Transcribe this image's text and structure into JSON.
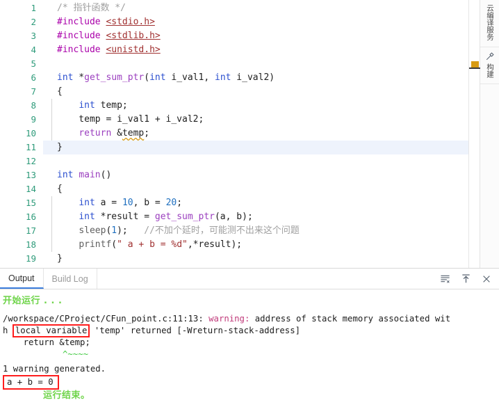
{
  "editor": {
    "lines": [
      {
        "no": "1",
        "guide": false,
        "highlight": false,
        "tokens": [
          {
            "c": "t-com",
            "t": "/* 指针函数 */"
          }
        ]
      },
      {
        "no": "2",
        "guide": false,
        "highlight": false,
        "tokens": [
          {
            "c": "t-pre",
            "t": "#include "
          },
          {
            "c": "t-hdr",
            "t": "<stdio.h>"
          }
        ]
      },
      {
        "no": "3",
        "guide": false,
        "highlight": false,
        "tokens": [
          {
            "c": "t-pre",
            "t": "#include "
          },
          {
            "c": "t-hdr",
            "t": "<stdlib.h>"
          }
        ]
      },
      {
        "no": "4",
        "guide": false,
        "highlight": false,
        "tokens": [
          {
            "c": "t-pre",
            "t": "#include "
          },
          {
            "c": "t-hdr",
            "t": "<unistd.h>"
          }
        ]
      },
      {
        "no": "5",
        "guide": false,
        "highlight": false,
        "tokens": []
      },
      {
        "no": "6",
        "guide": false,
        "highlight": false,
        "tokens": [
          {
            "c": "t-kw",
            "t": "int"
          },
          {
            "c": "t-op",
            "t": " *"
          },
          {
            "c": "t-fn",
            "t": "get_sum_ptr"
          },
          {
            "c": "t-op",
            "t": "("
          },
          {
            "c": "t-kw",
            "t": "int"
          },
          {
            "c": "t-id",
            "t": " i_val1, "
          },
          {
            "c": "t-kw",
            "t": "int"
          },
          {
            "c": "t-id",
            "t": " i_val2"
          },
          {
            "c": "t-op",
            "t": ")"
          }
        ]
      },
      {
        "no": "7",
        "guide": false,
        "highlight": false,
        "tokens": [
          {
            "c": "t-op",
            "t": "{"
          }
        ]
      },
      {
        "no": "8",
        "guide": true,
        "highlight": false,
        "tokens": [
          {
            "c": "t-op",
            "t": "    "
          },
          {
            "c": "t-kw",
            "t": "int"
          },
          {
            "c": "t-id",
            "t": " temp;"
          }
        ]
      },
      {
        "no": "9",
        "guide": true,
        "highlight": false,
        "tokens": [
          {
            "c": "t-id",
            "t": "    temp = i_val1 + i_val2;"
          }
        ]
      },
      {
        "no": "10",
        "guide": true,
        "highlight": false,
        "tokens": [
          {
            "c": "t-op",
            "t": "    "
          },
          {
            "c": "t-ret",
            "t": "return"
          },
          {
            "c": "t-id",
            "t": " &"
          },
          {
            "c": "t-id squig",
            "t": "temp"
          },
          {
            "c": "t-id",
            "t": ";"
          }
        ]
      },
      {
        "no": "11",
        "guide": false,
        "highlight": true,
        "tokens": [
          {
            "c": "t-op",
            "t": "}"
          }
        ]
      },
      {
        "no": "12",
        "guide": false,
        "highlight": false,
        "tokens": []
      },
      {
        "no": "13",
        "guide": false,
        "highlight": false,
        "tokens": [
          {
            "c": "t-kw",
            "t": "int"
          },
          {
            "c": "t-id",
            "t": " "
          },
          {
            "c": "t-fn",
            "t": "main"
          },
          {
            "c": "t-op",
            "t": "()"
          }
        ]
      },
      {
        "no": "14",
        "guide": false,
        "highlight": false,
        "tokens": [
          {
            "c": "t-op",
            "t": "{"
          }
        ]
      },
      {
        "no": "15",
        "guide": true,
        "highlight": false,
        "tokens": [
          {
            "c": "t-op",
            "t": "    "
          },
          {
            "c": "t-kw",
            "t": "int"
          },
          {
            "c": "t-id",
            "t": " a = "
          },
          {
            "c": "t-num",
            "t": "10"
          },
          {
            "c": "t-id",
            "t": ", b = "
          },
          {
            "c": "t-num",
            "t": "20"
          },
          {
            "c": "t-id",
            "t": ";"
          }
        ]
      },
      {
        "no": "16",
        "guide": true,
        "highlight": false,
        "tokens": [
          {
            "c": "t-op",
            "t": "    "
          },
          {
            "c": "t-kw",
            "t": "int"
          },
          {
            "c": "t-id",
            "t": " *result = "
          },
          {
            "c": "t-fn",
            "t": "get_sum_ptr"
          },
          {
            "c": "t-id",
            "t": "(a, b);"
          }
        ]
      },
      {
        "no": "17",
        "guide": true,
        "highlight": false,
        "tokens": [
          {
            "c": "t-op",
            "t": "    "
          },
          {
            "c": "t-call",
            "t": "sleep"
          },
          {
            "c": "t-op",
            "t": "("
          },
          {
            "c": "t-num",
            "t": "1"
          },
          {
            "c": "t-op",
            "t": ");"
          },
          {
            "c": "t-com",
            "t": "   //不加个延时，可能测不出来这个问题"
          }
        ]
      },
      {
        "no": "18",
        "guide": true,
        "highlight": false,
        "tokens": [
          {
            "c": "t-op",
            "t": "    "
          },
          {
            "c": "t-call",
            "t": "printf"
          },
          {
            "c": "t-op",
            "t": "("
          },
          {
            "c": "t-str",
            "t": "\" a + b = %d\""
          },
          {
            "c": "t-op",
            "t": ",*result);"
          }
        ]
      },
      {
        "no": "19",
        "guide": false,
        "highlight": false,
        "tokens": [
          {
            "c": "t-op",
            "t": "}"
          }
        ]
      }
    ]
  },
  "rail": {
    "items": [
      {
        "label": "云编译服务",
        "icon": ""
      },
      {
        "label": "构建",
        "icon": "hammer-icon"
      }
    ]
  },
  "panel": {
    "tabs": [
      {
        "label": "Output",
        "active": true
      },
      {
        "label": "Build Log",
        "active": false
      }
    ],
    "actions": [
      {
        "name": "clear-output-icon",
        "title": "Clear"
      },
      {
        "name": "scroll-to-top-icon",
        "title": "Scroll to top"
      },
      {
        "name": "close-panel-icon",
        "title": "Close"
      }
    ],
    "output": {
      "start_line": "开始运行 . . .",
      "warning_path": "/workspace/CProject/CFun_point.c:11:13: ",
      "warning_keyword": "warning:",
      "warning_rest": " address of stack memory associated wit",
      "warning_line2_pre": "h ",
      "warning_boxed": "local variable",
      "warning_line2_post": " 'temp' returned [-Wreturn-stack-address]",
      "warning_source": "    return &temp;",
      "caret_marker": "^~~~~",
      "summary": "1 warning generated.",
      "program_output_boxed": "a + b = 0",
      "end_line": "运行结束。"
    }
  },
  "colors": {
    "accent_blue": "#3b7ddd",
    "highlight_row": "#eef3fc",
    "annotation_red": "#ff1d1d",
    "terminal_green": "#6fd44a",
    "gutter_green": "#2e9b7a",
    "scroll_marker": "#d79a12"
  }
}
